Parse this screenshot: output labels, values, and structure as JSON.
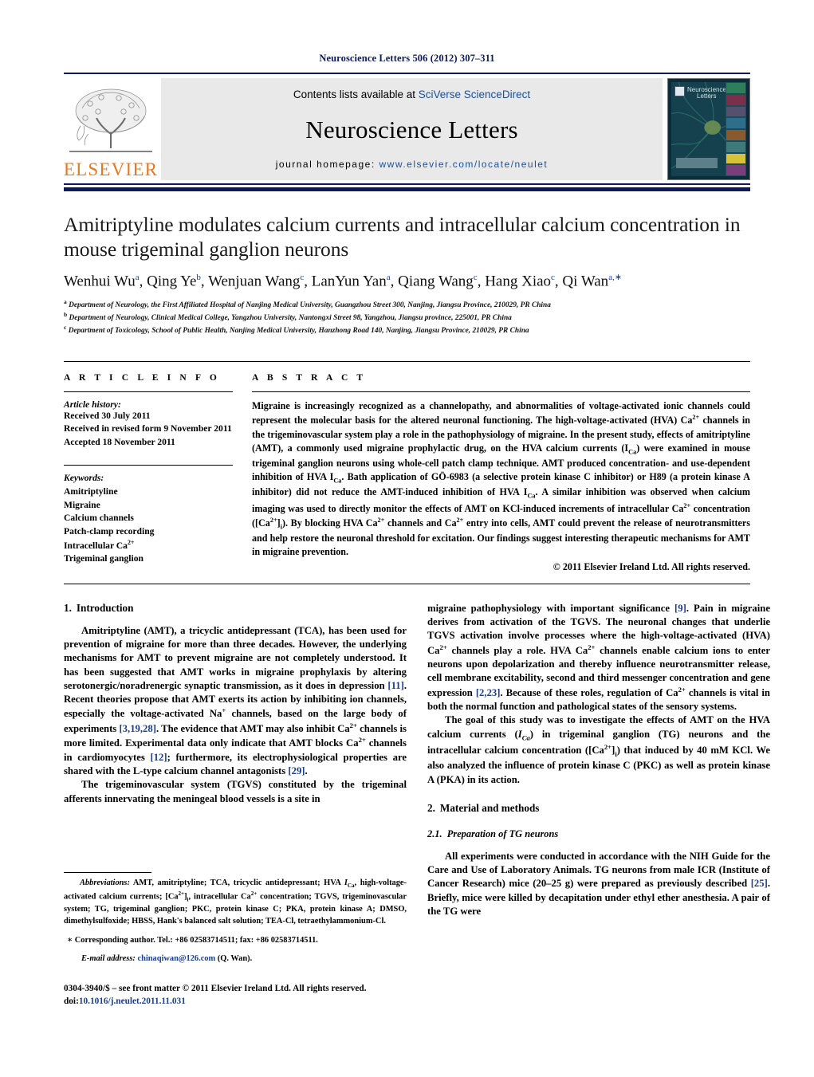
{
  "running_head": "Neuroscience Letters 506 (2012) 307–311",
  "masthead": {
    "publisher_name": "ELSEVIER",
    "contents_prefix": "Contents lists available at ",
    "contents_link": "SciVerse ScienceDirect",
    "journal_title": "Neuroscience Letters",
    "homepage_prefix": "journal homepage: ",
    "homepage_url": "www.elsevier.com/locate/neulet",
    "cover_title_line1": "Neuroscience",
    "cover_title_line2": "Letters"
  },
  "article": {
    "title": "Amitriptyline modulates calcium currents and intracellular calcium concentration in mouse trigeminal ganglion neurons",
    "authors_html": "Wenhui Wu<sup>a</sup>, Qing Ye<sup>b</sup>, Wenjuan Wang<sup>c</sup>, LanYun Yan<sup>a</sup>, Qiang Wang<sup>c</sup>, Hang Xiao<sup>c</sup>, Qi Wan<sup>a,</sup><sup>∗</sup>",
    "affiliations": [
      {
        "marker": "a",
        "text": "Department of Neurology, the First Affiliated Hospital of Nanjing Medical University, Guangzhou Street 300, Nanjing, Jiangsu Province, 210029, PR China"
      },
      {
        "marker": "b",
        "text": "Department of Neurology, Clinical Medical College, Yangzhou University, Nantongxi Street 98, Yangzhou, Jiangsu province, 225001, PR China"
      },
      {
        "marker": "c",
        "text": "Department of Toxicology, School of Public Health, Nanjing Medical University, Hanzhong Road 140, Nanjing, Jiangsu Province, 210029, PR China"
      }
    ]
  },
  "article_info": {
    "heading": "A R T I C L E    I N F O",
    "history_label": "Article history:",
    "history": [
      "Received 30 July 2011",
      "Received in revised form 9 November 2011",
      "Accepted 18 November 2011"
    ],
    "keywords_label": "Keywords:",
    "keywords": [
      "Amitriptyline",
      "Migraine",
      "Calcium channels",
      "Patch-clamp recording",
      "Intracellular Ca2+",
      "Trigeminal ganglion"
    ]
  },
  "abstract": {
    "heading": "A B S T R A C T",
    "body_html": "Migraine is increasingly recognized as a channelopathy, and abnormalities of voltage-activated ionic channels could represent the molecular basis for the altered neuronal functioning. The high-voltage-activated (HVA) Ca<sup class=\"sm\">2+</sup> channels in the trigeminovascular system play a role in the pathophysiology of migraine. In the present study, effects of amitriptyline (AMT), a commonly used migraine prophylactic drug, on the HVA calcium currents (I<sub class=\"sm\">Ca</sub>) were examined in mouse trigeminal ganglion neurons using whole-cell patch clamp technique. AMT produced concentration- and use-dependent inhibition of HVA I<sub class=\"sm\">Ca</sub>. Bath application of GÖ-6983 (a selective protein kinase C inhibitor) or H89 (a protein kinase A inhibitor) did not reduce the AMT-induced inhibition of HVA I<sub class=\"sm\">Ca</sub>. A similar inhibition was observed when calcium imaging was used to directly monitor the effects of AMT on KCl-induced increments of intracellular Ca<sup class=\"sm\">2+</sup> concentration ([Ca<sup class=\"sm\">2+</sup>]<sub class=\"sm\">i</sub>). By blocking HVA Ca<sup class=\"sm\">2+</sup> channels and Ca<sup class=\"sm\">2+</sup> entry into cells, AMT could prevent the release of neurotransmitters and help restore the neuronal threshold for excitation. Our findings suggest interesting therapeutic mechanisms for AMT in migraine prevention.",
    "copyright": "© 2011 Elsevier Ireland Ltd. All rights reserved."
  },
  "sections": {
    "intro_number": "1.",
    "intro_title": "Introduction",
    "intro_p1_html": "Amitriptyline (AMT), a tricyclic antidepressant (TCA), has been used for prevention of migraine for more than three decades. However, the underlying mechanisms for AMT to prevent migraine are not completely understood. It has been suggested that AMT works in migraine prophylaxis by altering serotonergic/noradrenergic synaptic transmission, as it does in depression <span class=\"ref\">[11]</span>. Recent theories propose that AMT exerts its action by inhibiting ion channels, especially the voltage-activated Na<sup class=\"sm\">+</sup> channels, based on the large body of experiments <span class=\"ref\">[3,19,28]</span>. The evidence that AMT may also inhibit Ca<sup class=\"sm\">2+</sup> channels is more limited. Experimental data only indicate that AMT blocks Ca<sup class=\"sm\">2+</sup> channels in cardiomyocytes <span class=\"ref\">[12]</span>; furthermore, its electrophysiological properties are shared with the L-type calcium channel antagonists <span class=\"ref\">[29]</span>.",
    "intro_p2_html": "The trigeminovascular system (TGVS) constituted by the trigeminal afferents innervating the meningeal blood vessels is a site in",
    "intro_p2_cont_html": "migraine pathophysiology with important significance <span class=\"ref\">[9]</span>. Pain in migraine derives from activation of the TGVS. The neuronal changes that underlie TGVS activation involve processes where the high-voltage-activated (HVA) Ca<sup class=\"sm\">2+</sup> channels play a role. HVA Ca<sup class=\"sm\">2+</sup> channels enable calcium ions to enter neurons upon depolarization and thereby influence neurotransmitter release, cell membrane excitability, second and third messenger concentration and gene expression <span class=\"ref\">[2,23]</span>. Because of these roles, regulation of Ca<sup class=\"sm\">2+</sup> channels is vital in both the normal function and pathological states of the sensory systems.",
    "intro_p3_html": "The goal of this study was to investigate the effects of AMT on the HVA calcium currents (<i class=\"it\">I</i><sub class=\"sm\"><i class=\"it\">Ca</i></sub>) in trigeminal ganglion (TG) neurons and the intracellular calcium concentration ([Ca<sup class=\"sm\">2+</sup>]<sub class=\"sm\">i</sub>) that induced by 40 mM KCl. We also analyzed the influence of protein kinase C (PKC) as well as protein kinase A (PKA) in its action.",
    "methods_number": "2.",
    "methods_title": "Material and methods",
    "methods_sub_number": "2.1.",
    "methods_sub_title": "Preparation of TG neurons",
    "methods_p1_html": "All experiments were conducted in accordance with the NIH Guide for the Care and Use of Laboratory Animals. TG neurons from male ICR (Institute of Cancer Research) mice (20–25 g) were prepared as previously described <span class=\"ref\">[25]</span>. Briefly, mice were killed by decapitation under ethyl ether anesthesia. A pair of the TG were"
  },
  "footnotes": {
    "abbreviations_html": "<span class=\"lead\">Abbreviations:</span> AMT, amitriptyline; TCA, tricyclic antidepressant; HVA <i class=\"it\">I</i><sub class=\"sm\">Ca</sub>, high-voltage-activated calcium currents; [Ca<sup class=\"sm\">2+</sup>]<sub class=\"sm\">i</sub>, intracellular Ca<sup class=\"sm\">2+</sup> concentration; TGVS, trigeminovascular system; TG, trigeminal ganglion; PKC, protein kinase C; PKA, protein kinase A; DMSO, dimethylsulfoxide; HBSS, Hank's balanced salt solution; TEA-Cl, tetraethylammonium-Cl.",
    "corresponding_html": "∗ Corresponding author. Tel.: +86 02583714511; fax: +86 02583714511.",
    "email_label": "E-mail address:",
    "email_address": "chinaqiwan@126.com",
    "email_suffix": "(Q. Wan).",
    "issn_line": "0304-3940/$ – see front matter © 2011 Elsevier Ireland Ltd. All rights reserved.",
    "doi_label": "doi:",
    "doi_value": "10.1016/j.neulet.2011.11.031"
  },
  "colors": {
    "navy": "#0d1a5e",
    "link_blue": "#1a3e8c",
    "elsevier_orange": "#e87722",
    "band_gray": "#e9e9e9"
  }
}
